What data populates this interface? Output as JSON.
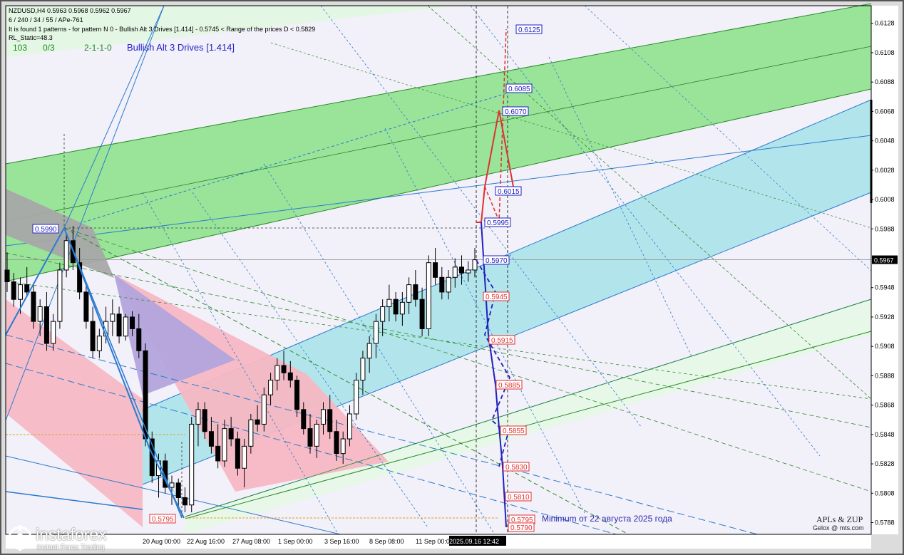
{
  "header": {
    "line1": "NZDUSD,H4  0.5963 0.5968 0.5962 0.5967",
    "line2": "6 / 240 / 34 / 55 / APe-761",
    "line3": "It is found 1 patterns  -  for pattern N 0 - Bullish Alt 3 Drives [1.414] - 0.5745 < Range of the prices D < 0.5829",
    "line4": "RL_Static=48.3",
    "stat_a": "103",
    "stat_b": "0/3",
    "stat_c": "2-1-1-0",
    "pattern_name": "Bullish Alt 3 Drives [1.414]"
  },
  "brand": {
    "logo_text": "instaforex",
    "logo_sub": "Instant Forex Trading",
    "apl_title": "APLs & ZUP",
    "apl_sub": "Gelox @ mts.com"
  },
  "annotation": "Minimum от 22 августа 2025 года",
  "current_price": "0.5967",
  "chart_data": {
    "type": "candlestick",
    "symbol": "NZDUSD",
    "timeframe": "H4",
    "ylim": [
      0.578,
      0.614
    ],
    "y_ticks": [
      "0.6128",
      "0.6108",
      "0.6088",
      "0.6068",
      "0.6048",
      "0.6028",
      "0.6008",
      "0.5988",
      "0.5967",
      "0.5948",
      "0.5928",
      "0.5908",
      "0.5888",
      "0.5868",
      "0.5848",
      "0.5828",
      "0.5808",
      "0.5788"
    ],
    "x_ticks": [
      "20 Aug 00:00",
      "22 Aug 16:00",
      "27 Aug 08:00",
      "1 Sep 00:00",
      "3 Sep 16:00",
      "8 Sep 08:00",
      "11 Sep 00:00",
      "2025.09.16 12:42"
    ],
    "candles": [
      [
        0.596,
        0.5972,
        0.5945,
        0.5952
      ],
      [
        0.5952,
        0.5958,
        0.5935,
        0.594
      ],
      [
        0.594,
        0.5955,
        0.593,
        0.595
      ],
      [
        0.595,
        0.5962,
        0.5942,
        0.5945
      ],
      [
        0.5945,
        0.595,
        0.592,
        0.5925
      ],
      [
        0.5925,
        0.594,
        0.5915,
        0.5935
      ],
      [
        0.5935,
        0.5945,
        0.5905,
        0.591
      ],
      [
        0.591,
        0.593,
        0.5905,
        0.5925
      ],
      [
        0.5925,
        0.5965,
        0.592,
        0.596
      ],
      [
        0.596,
        0.5985,
        0.5955,
        0.598
      ],
      [
        0.598,
        0.599,
        0.596,
        0.5965
      ],
      [
        0.5965,
        0.5975,
        0.594,
        0.5945
      ],
      [
        0.5945,
        0.595,
        0.592,
        0.5925
      ],
      [
        0.5925,
        0.5935,
        0.59,
        0.5905
      ],
      [
        0.5905,
        0.592,
        0.59,
        0.5915
      ],
      [
        0.5915,
        0.5935,
        0.591,
        0.5925
      ],
      [
        0.5925,
        0.594,
        0.5915,
        0.593
      ],
      [
        0.593,
        0.5935,
        0.591,
        0.5915
      ],
      [
        0.5915,
        0.593,
        0.5912,
        0.5928
      ],
      [
        0.5928,
        0.5932,
        0.5915,
        0.592
      ],
      [
        0.592,
        0.593,
        0.59,
        0.5905
      ],
      [
        0.5905,
        0.591,
        0.584,
        0.5845
      ],
      [
        0.5845,
        0.585,
        0.5815,
        0.582
      ],
      [
        0.582,
        0.5835,
        0.5805,
        0.583
      ],
      [
        0.583,
        0.5835,
        0.5808,
        0.5812
      ],
      [
        0.5812,
        0.582,
        0.58,
        0.5815
      ],
      [
        0.5815,
        0.5818,
        0.5798,
        0.5805
      ],
      [
        0.5805,
        0.5812,
        0.5795,
        0.58
      ],
      [
        0.58,
        0.586,
        0.5795,
        0.5855
      ],
      [
        0.5855,
        0.587,
        0.584,
        0.5865
      ],
      [
        0.5865,
        0.587,
        0.5845,
        0.585
      ],
      [
        0.585,
        0.586,
        0.5835,
        0.584
      ],
      [
        0.584,
        0.5855,
        0.5825,
        0.583
      ],
      [
        0.583,
        0.5858,
        0.5826,
        0.5852
      ],
      [
        0.5852,
        0.586,
        0.584,
        0.5845
      ],
      [
        0.5845,
        0.585,
        0.582,
        0.5825
      ],
      [
        0.5825,
        0.5845,
        0.5812,
        0.584
      ],
      [
        0.584,
        0.5862,
        0.5835,
        0.5858
      ],
      [
        0.5858,
        0.5868,
        0.585,
        0.5855
      ],
      [
        0.5855,
        0.588,
        0.585,
        0.5875
      ],
      [
        0.5875,
        0.589,
        0.5868,
        0.5885
      ],
      [
        0.5885,
        0.59,
        0.5878,
        0.5895
      ],
      [
        0.5895,
        0.5905,
        0.5885,
        0.589
      ],
      [
        0.589,
        0.5898,
        0.588,
        0.5885
      ],
      [
        0.5885,
        0.5888,
        0.586,
        0.5865
      ],
      [
        0.5865,
        0.587,
        0.5848,
        0.5852
      ],
      [
        0.5852,
        0.5862,
        0.5835,
        0.584
      ],
      [
        0.584,
        0.5858,
        0.5832,
        0.5855
      ],
      [
        0.5855,
        0.587,
        0.5848,
        0.5865
      ],
      [
        0.5865,
        0.5875,
        0.5845,
        0.585
      ],
      [
        0.585,
        0.5858,
        0.583,
        0.5835
      ],
      [
        0.5835,
        0.585,
        0.5828,
        0.5845
      ],
      [
        0.5845,
        0.5868,
        0.584,
        0.5862
      ],
      [
        0.5862,
        0.589,
        0.5858,
        0.5885
      ],
      [
        0.5885,
        0.5905,
        0.5875,
        0.59
      ],
      [
        0.59,
        0.5915,
        0.589,
        0.591
      ],
      [
        0.591,
        0.593,
        0.59,
        0.5925
      ],
      [
        0.5925,
        0.594,
        0.5915,
        0.5935
      ],
      [
        0.5935,
        0.595,
        0.5925,
        0.594
      ],
      [
        0.594,
        0.5945,
        0.5925,
        0.593
      ],
      [
        0.593,
        0.5945,
        0.5922,
        0.5938
      ],
      [
        0.5938,
        0.5955,
        0.593,
        0.595
      ],
      [
        0.595,
        0.596,
        0.5935,
        0.594
      ],
      [
        0.594,
        0.5948,
        0.5915,
        0.592
      ],
      [
        0.592,
        0.597,
        0.5915,
        0.5965
      ],
      [
        0.5965,
        0.5975,
        0.595,
        0.5955
      ],
      [
        0.5955,
        0.5962,
        0.594,
        0.5945
      ],
      [
        0.5945,
        0.596,
        0.594,
        0.5955
      ],
      [
        0.5955,
        0.5968,
        0.5948,
        0.5962
      ],
      [
        0.5962,
        0.597,
        0.595,
        0.5958
      ],
      [
        0.5958,
        0.5966,
        0.5952,
        0.596
      ],
      [
        0.596,
        0.5975,
        0.5955,
        0.5967
      ]
    ],
    "zup_labels_blue": [
      "0.6125",
      "0.6085",
      "0.6070",
      "0.6015",
      "0.5995",
      "0.5970",
      "0.5990"
    ],
    "zup_labels_red": [
      "0.5945",
      "0.5915",
      "0.5885",
      "0.5855",
      "0.5830",
      "0.5810",
      "0.5795",
      "0.5790",
      "0.5795"
    ]
  }
}
